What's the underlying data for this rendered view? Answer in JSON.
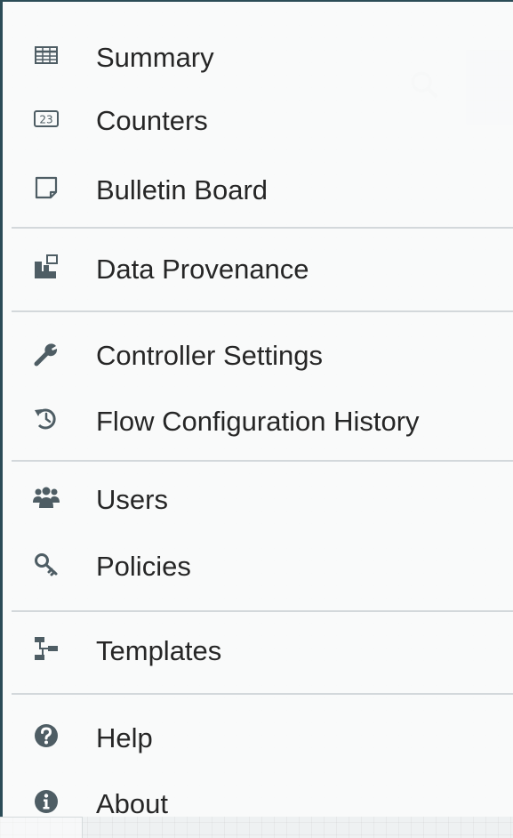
{
  "menu": {
    "items": [
      {
        "label": "Summary",
        "icon": "table-icon"
      },
      {
        "label": "Counters",
        "icon": "counter-icon"
      },
      {
        "label": "Bulletin Board",
        "icon": "bulletin-icon"
      },
      {
        "label": "Data Provenance",
        "icon": "provenance-icon"
      },
      {
        "label": "Controller Settings",
        "icon": "wrench-icon"
      },
      {
        "label": "Flow Configuration History",
        "icon": "history-icon"
      },
      {
        "label": "Users",
        "icon": "users-icon"
      },
      {
        "label": "Policies",
        "icon": "key-icon"
      },
      {
        "label": "Templates",
        "icon": "templates-icon"
      },
      {
        "label": "Help",
        "icon": "help-icon"
      },
      {
        "label": "About",
        "icon": "info-icon"
      }
    ],
    "counter_icon_text": "23"
  },
  "colors": {
    "icon": "#4e5d64",
    "text": "#262626",
    "border": "#2b4c57",
    "separator": "#d3d8db"
  }
}
